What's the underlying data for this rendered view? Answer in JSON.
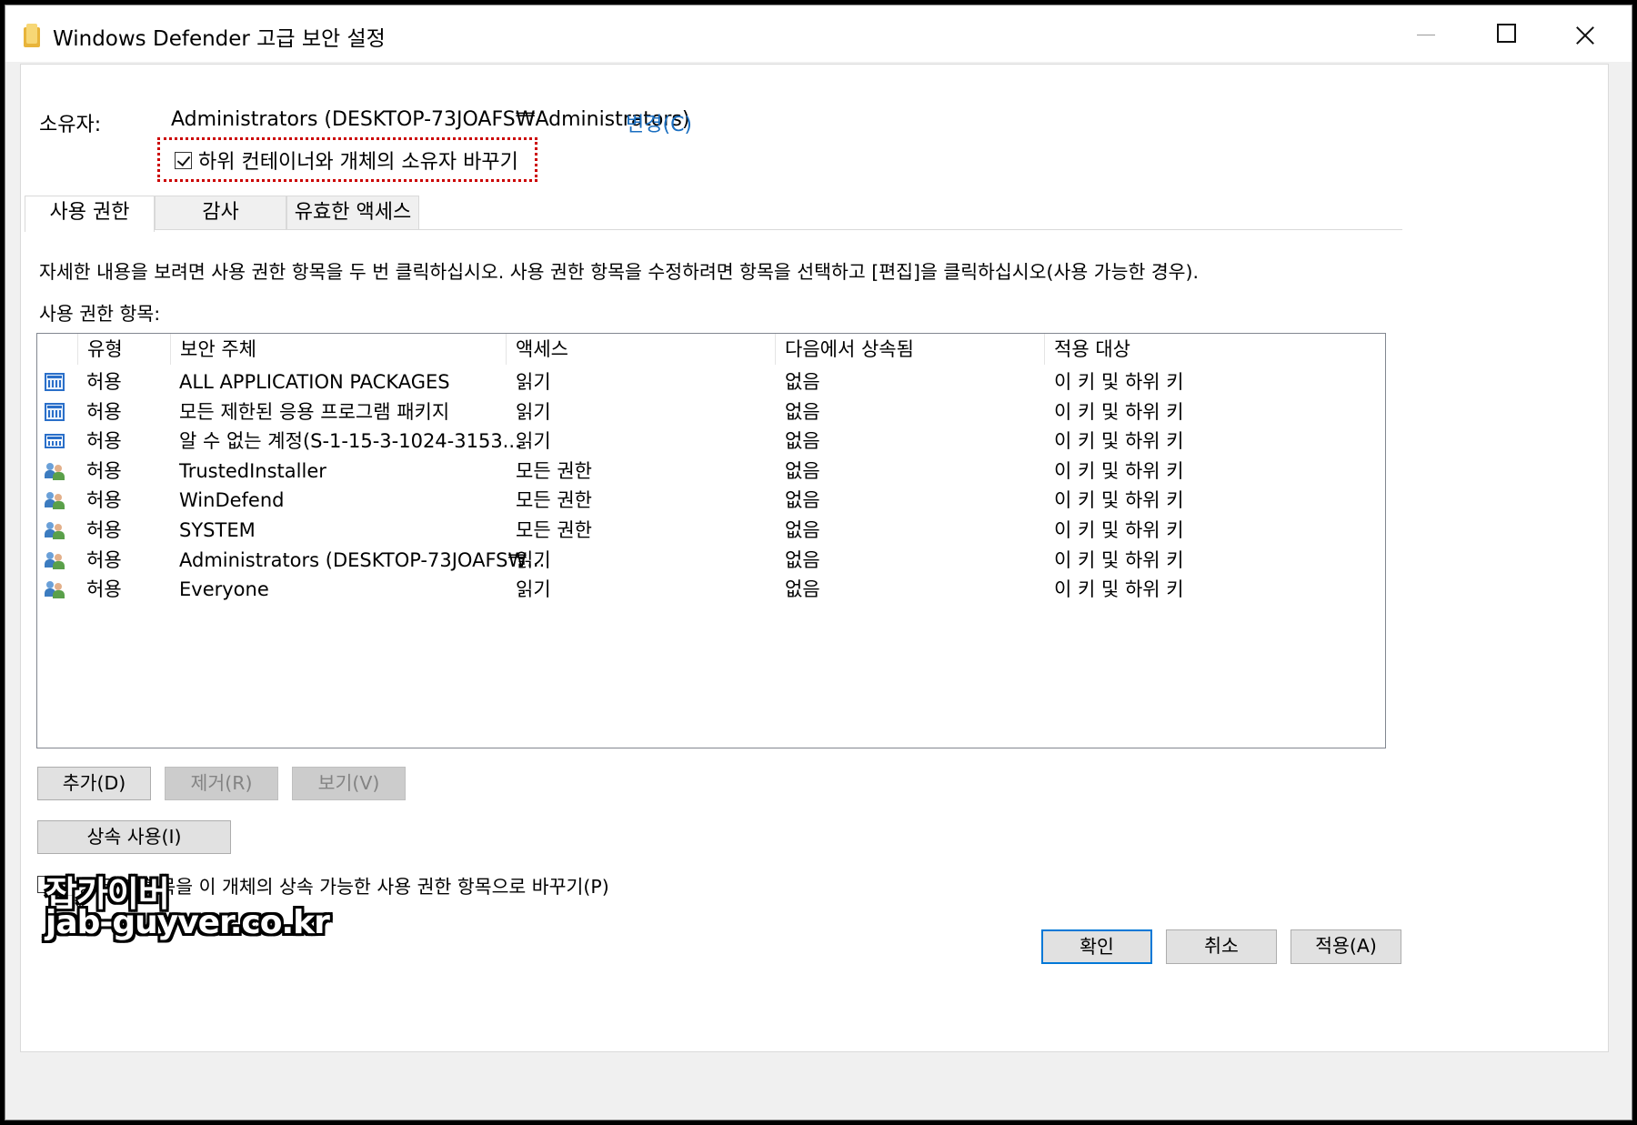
{
  "window": {
    "title": "Windows Defender 고급 보안 설정"
  },
  "owner": {
    "label": "소유자:",
    "value": "Administrators (DESKTOP-73JOAFS₩Administrators)",
    "change_link": "변경(C)",
    "replace_checkbox_label": "하위 컨테이너와 개체의 소유자 바꾸기",
    "replace_checked": true
  },
  "tabs": [
    {
      "label": "사용 권한",
      "active": true
    },
    {
      "label": "감사",
      "active": false
    },
    {
      "label": "유효한 액세스",
      "active": false
    }
  ],
  "instructions": "자세한 내용을 보려면 사용 권한 항목을 두 번 클릭하십시오. 사용 권한 항목을 수정하려면 항목을 선택하고 [편집]을 클릭하십시오(사용 가능한 경우).",
  "entries_label": "사용 권한 항목:",
  "columns": [
    "유형",
    "보안 주체",
    "액세스",
    "다음에서 상속됨",
    "적용 대상"
  ],
  "rows": [
    {
      "icon": "app-package-icon",
      "type": "허용",
      "principal": "ALL APPLICATION PACKAGES",
      "access": "읽기",
      "inherited": "없음",
      "applies": "이 키 및 하위 키"
    },
    {
      "icon": "app-package-icon",
      "type": "허용",
      "principal": "모든 제한된 응용 프로그램 패키지",
      "access": "읽기",
      "inherited": "없음",
      "applies": "이 키 및 하위 키"
    },
    {
      "icon": "unknown-account-icon",
      "type": "허용",
      "principal": "알 수 없는 계정(S-1-15-3-1024-3153...",
      "access": "읽기",
      "inherited": "없음",
      "applies": "이 키 및 하위 키"
    },
    {
      "icon": "users-icon",
      "type": "허용",
      "principal": "TrustedInstaller",
      "access": "모든 권한",
      "inherited": "없음",
      "applies": "이 키 및 하위 키"
    },
    {
      "icon": "users-icon",
      "type": "허용",
      "principal": "WinDefend",
      "access": "모든 권한",
      "inherited": "없음",
      "applies": "이 키 및 하위 키"
    },
    {
      "icon": "users-icon",
      "type": "허용",
      "principal": "SYSTEM",
      "access": "모든 권한",
      "inherited": "없음",
      "applies": "이 키 및 하위 키"
    },
    {
      "icon": "users-icon",
      "type": "허용",
      "principal": "Administrators (DESKTOP-73JOAFS₩...",
      "access": "읽기",
      "inherited": "없음",
      "applies": "이 키 및 하위 키"
    },
    {
      "icon": "users-icon",
      "type": "허용",
      "principal": "Everyone",
      "access": "읽기",
      "inherited": "없음",
      "applies": "이 키 및 하위 키"
    }
  ],
  "buttons": {
    "add": "추가(D)",
    "remove": "제거(R)",
    "view": "보기(V)",
    "inherit": "상속 사용(I)",
    "ok": "확인",
    "cancel": "취소",
    "apply": "적용(A)"
  },
  "replace_permissions_label": "사용 권한 항목을 이 개체의 상속 가능한 사용 권한 항목으로 바꾸기(P)",
  "watermark": {
    "line1": "잡가이버",
    "line2": "jab-guyver.co.kr"
  },
  "colors": {
    "link": "#1a6ec0",
    "highlight_box": "#cc0000",
    "default_button_border": "#0078d7"
  }
}
